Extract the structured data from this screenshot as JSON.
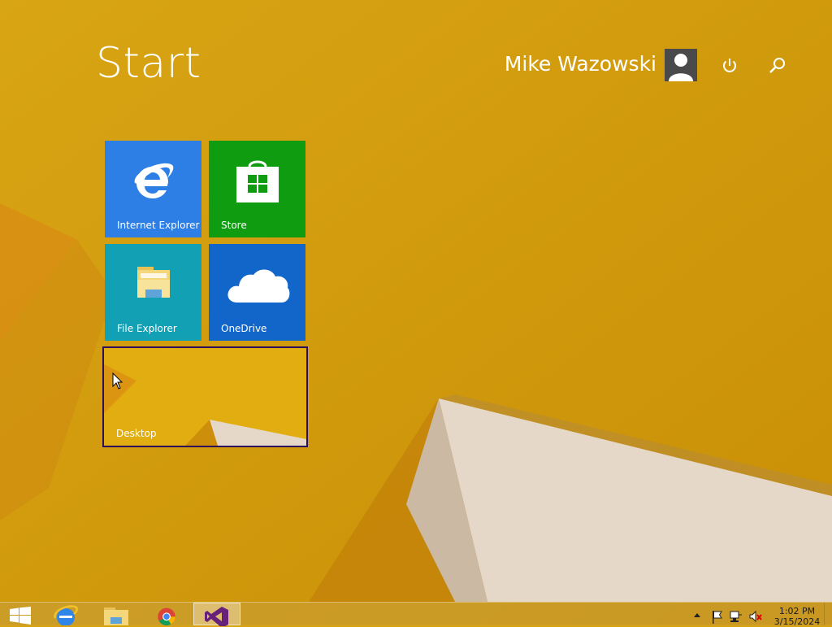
{
  "start_screen": {
    "title": "Start",
    "user": {
      "name": "Mike Wazowski"
    }
  },
  "tiles": [
    {
      "label": "Internet Explorer",
      "color": "#2d7fe6"
    },
    {
      "label": "Store",
      "color": "#109c10"
    },
    {
      "label": "File Explorer",
      "color": "#11a0b4"
    },
    {
      "label": "OneDrive",
      "color": "#1266c9"
    },
    {
      "label": "Desktop"
    }
  ],
  "taskbar": {
    "pinned": [
      "windows-start-icon",
      "internet-explorer-icon",
      "file-explorer-icon",
      "chrome-icon",
      "visual-studio-icon"
    ],
    "tray_icons": [
      "show-hidden-icons-chevron",
      "action-center-flag-icon",
      "network-icon",
      "volume-muted-icon"
    ],
    "clock": {
      "time": "1:02 PM",
      "date": "3/15/2024"
    }
  },
  "colors": {
    "background": "#d7a10f",
    "accent_border": "#2d0f5a"
  }
}
